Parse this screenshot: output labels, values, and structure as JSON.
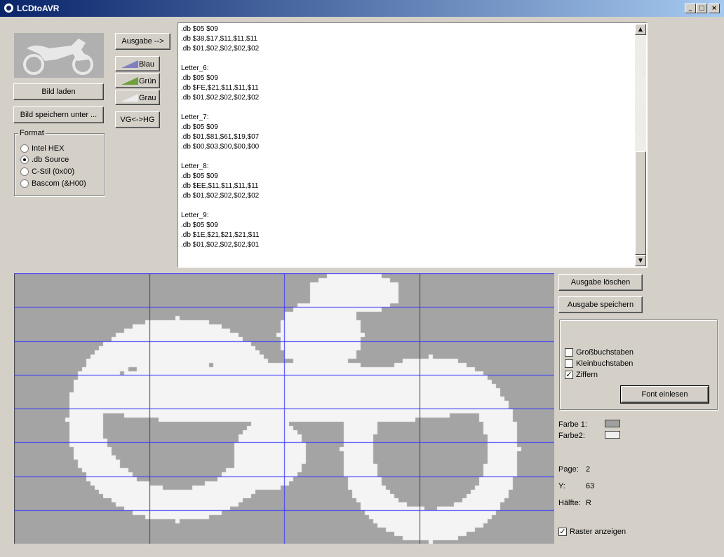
{
  "window": {
    "title": "LCDtoAVR",
    "min": "_",
    "max": "□",
    "close": "×"
  },
  "buttons": {
    "bild_laden": "Bild laden",
    "bild_speichern": "Bild speichern unter ...",
    "ausgabe": "Ausgabe -->",
    "blau": "Blau",
    "gruen": "Grün",
    "grau": "Grau",
    "vg_hg": "VG<->HG",
    "ausgabe_loeschen": "Ausgabe löschen",
    "ausgabe_speichern": "Ausgabe speichern",
    "font_einlesen": "Font einlesen"
  },
  "format": {
    "legend": "Format",
    "options": [
      "Intel HEX",
      ".db Source",
      "C-Stil (0x00)",
      "Bascom (&H00)"
    ],
    "selected": 1
  },
  "colors": {
    "blau": "#8080c0",
    "gruen": "#70a040",
    "grau": "#e0e0e0",
    "farbe1": "#a0a0a0",
    "farbe2": "#f0f0f0",
    "grid_fg": "#f4f4f4",
    "grid_bg": "#a4a4a4",
    "grid_line": "#404040",
    "grid_major": "#3a3aff"
  },
  "output_lines": [
    ".db $05 $09",
    ".db $38,$17,$11,$11,$11",
    ".db $01,$02,$02,$02,$02",
    "",
    "Letter_6:",
    ".db $05 $09",
    ".db $FE,$21,$11,$11,$11",
    ".db $01,$02,$02,$02,$02",
    "",
    "Letter_7:",
    ".db $05 $09",
    ".db $01,$81,$61,$19,$07",
    ".db $00,$03,$00,$00,$00",
    "",
    "Letter_8:",
    ".db $05 $09",
    ".db $EE,$11,$11,$11,$11",
    ".db $01,$02,$02,$02,$02",
    "",
    "Letter_9:",
    ".db $05 $09",
    ".db $1E,$21,$21,$21,$11",
    ".db $01,$02,$02,$02,$01"
  ],
  "font_options": [
    {
      "label": "Großbuchstaben",
      "checked": false
    },
    {
      "label": "Kleinbuchstaben",
      "checked": false
    },
    {
      "label": "Ziffern",
      "checked": true
    }
  ],
  "farbe1_label": "Farbe 1:",
  "farbe2_label": "Farbe2:",
  "status": {
    "page_label": "Page:",
    "page_value": "2",
    "y_label": "Y:",
    "y_value": "63",
    "haelfte_label": "Hälfte:",
    "haelfte_value": "R"
  },
  "raster": {
    "label": "Raster anzeigen",
    "checked": true
  }
}
